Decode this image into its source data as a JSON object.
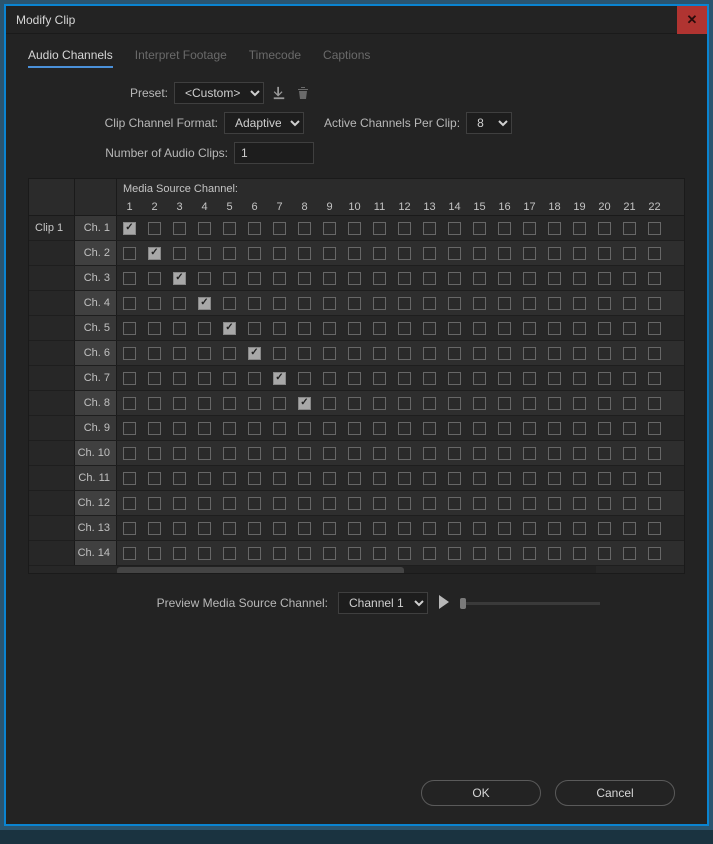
{
  "window": {
    "title": "Modify Clip"
  },
  "tabs": [
    "Audio Channels",
    "Interpret Footage",
    "Timecode",
    "Captions"
  ],
  "activeTab": 0,
  "labels": {
    "preset": "Preset:",
    "clipChannelFormat": "Clip Channel Format:",
    "activeChannels": "Active Channels Per Clip:",
    "numClips": "Number of Audio Clips:",
    "mediaSource": "Media Source Channel:",
    "preview": "Preview Media Source Channel:",
    "ok": "OK",
    "cancel": "Cancel"
  },
  "preset": "<Custom>",
  "clipChannelFormat": "Adaptive",
  "activeChannelsPerClip": "8",
  "numberOfAudioClips": "1",
  "cols": [
    1,
    2,
    3,
    4,
    5,
    6,
    7,
    8,
    9,
    10,
    11,
    12,
    13,
    14,
    15,
    16,
    17,
    18,
    19,
    20,
    21,
    22
  ],
  "clipLabel": "Clip 1",
  "rows": [
    {
      "label": "Ch. 1",
      "checked": [
        1
      ]
    },
    {
      "label": "Ch. 2",
      "checked": [
        2
      ]
    },
    {
      "label": "Ch. 3",
      "checked": [
        3
      ]
    },
    {
      "label": "Ch. 4",
      "checked": [
        4
      ]
    },
    {
      "label": "Ch. 5",
      "checked": [
        5
      ]
    },
    {
      "label": "Ch. 6",
      "checked": [
        6
      ]
    },
    {
      "label": "Ch. 7",
      "checked": [
        7
      ]
    },
    {
      "label": "Ch. 8",
      "checked": [
        8
      ]
    },
    {
      "label": "Ch. 9",
      "checked": []
    },
    {
      "label": "Ch. 10",
      "checked": []
    },
    {
      "label": "Ch. 11",
      "checked": []
    },
    {
      "label": "Ch. 12",
      "checked": []
    },
    {
      "label": "Ch. 13",
      "checked": []
    },
    {
      "label": "Ch. 14",
      "checked": []
    }
  ],
  "previewChannel": "Channel 1"
}
